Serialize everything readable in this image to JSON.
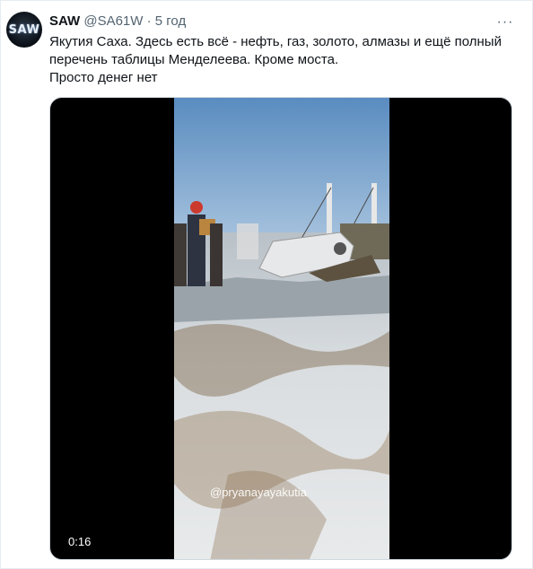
{
  "tweet": {
    "avatar_text": "SAW",
    "display_name": "SAW",
    "handle": "@SA61W",
    "separator": "·",
    "time": "5 год",
    "more_icon": "ellipsis-icon",
    "text_lines": [
      "Якутия Саха. Здесь есть всё - нефть, газ, золото, алмазы и ещё полный",
      "перечень таблицы Менделеева. Кроме моста.",
      "Просто денег нет"
    ]
  },
  "media": {
    "watermark": "@pryanayayakutia",
    "duration": "0:16"
  },
  "colors": {
    "text": "#0f1419",
    "secondary": "#536471",
    "border": "#e6ecf0",
    "media_background": "#000000"
  }
}
